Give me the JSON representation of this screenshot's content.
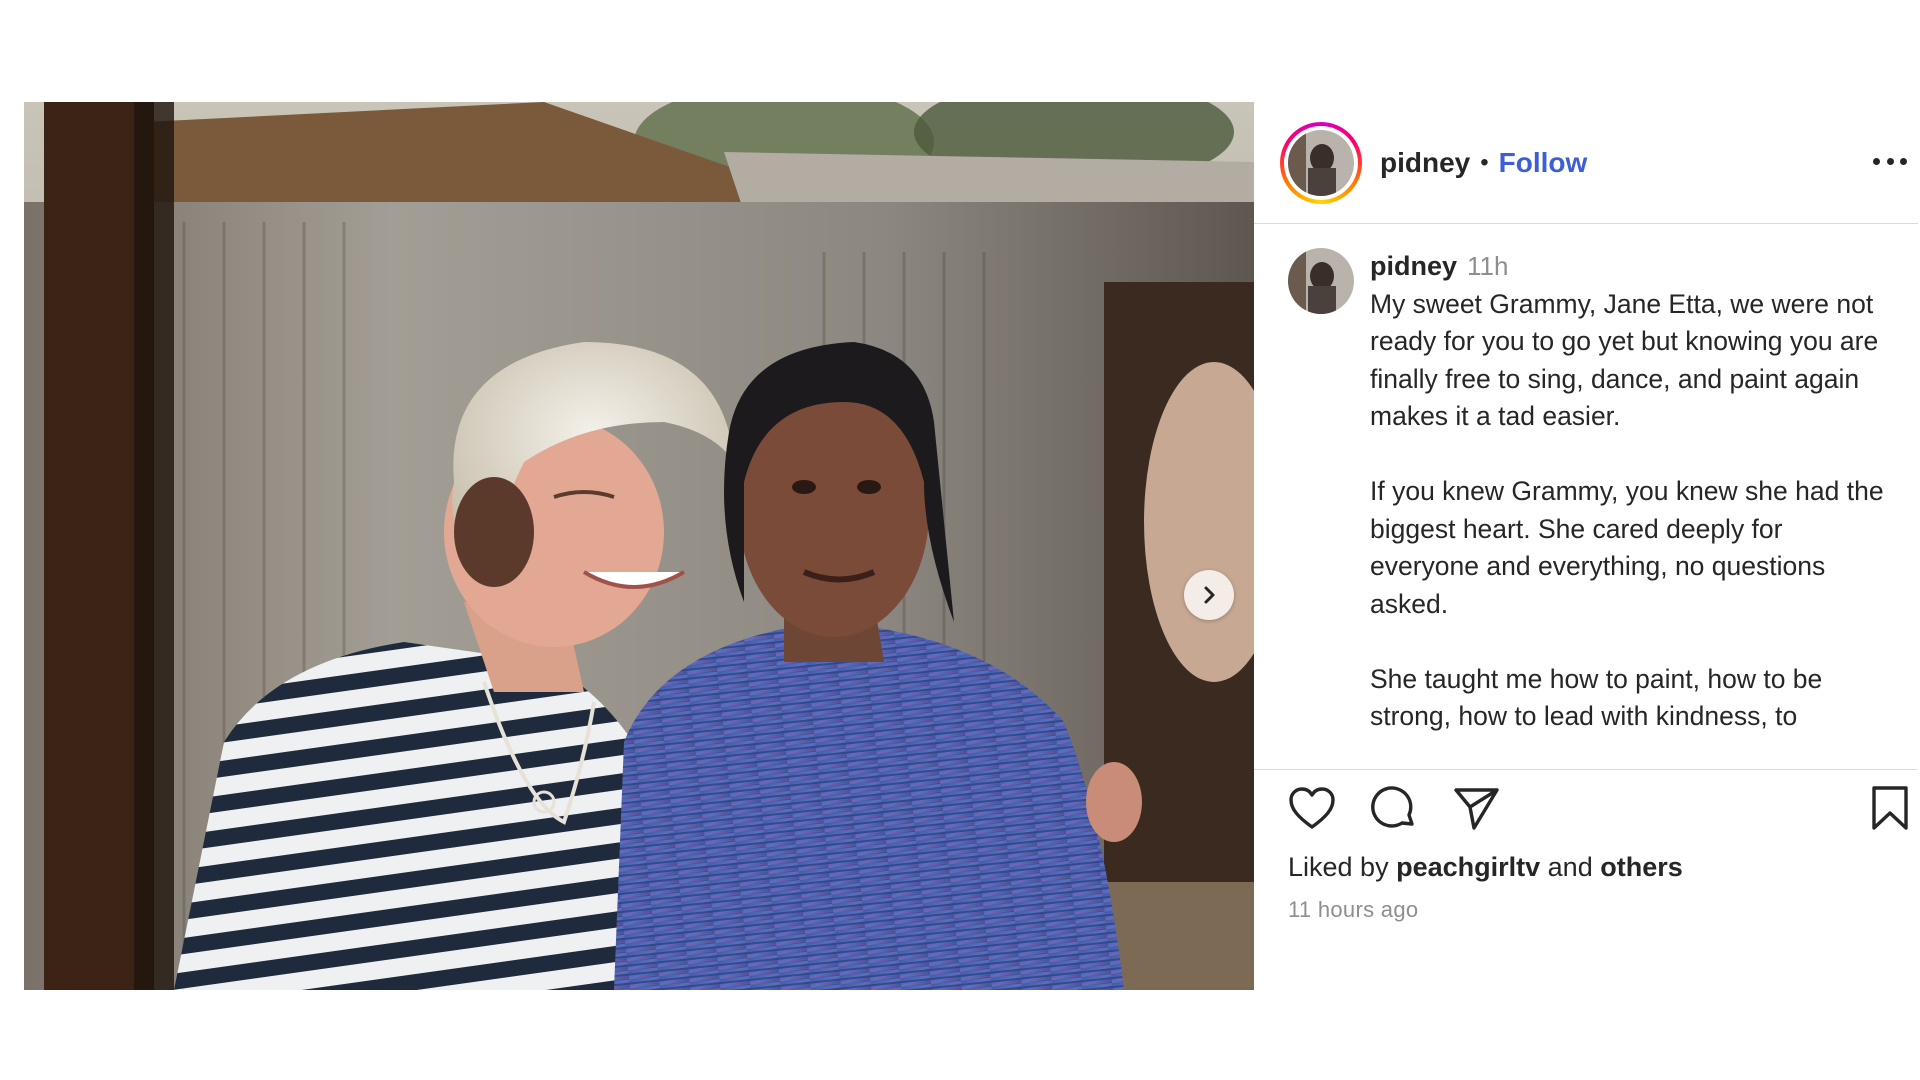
{
  "post": {
    "username": "pidney",
    "follow_label": "Follow",
    "separator": "•",
    "media": {
      "description_icon": "photo",
      "next_icon": "chevron-right-icon"
    },
    "caption": {
      "username": "pidney",
      "time_ago": "11h",
      "paragraphs": [
        "My sweet Grammy, Jane Etta, we were not ready for you to go yet but knowing you are finally free to sing, dance, and paint again makes it a tad easier.",
        "If you knew Grammy, you knew she had the biggest heart. She cared deeply for everyone and everything, no questions asked.",
        "She taught me how to paint, how to be strong, how to lead with kindness, to"
      ]
    },
    "actions": {
      "like_icon": "heart-icon",
      "comment_icon": "comment-icon",
      "share_icon": "send-icon",
      "save_icon": "bookmark-icon"
    },
    "likes": {
      "prefix": "Liked by",
      "user": "peachgirltv",
      "conjunction": "and",
      "others": "others"
    },
    "timestamp": "11 hours ago"
  },
  "colors": {
    "follow": "#3d5ed6",
    "text": "#262626",
    "muted": "#8e8e8e",
    "divider": "#dbdbdb"
  }
}
